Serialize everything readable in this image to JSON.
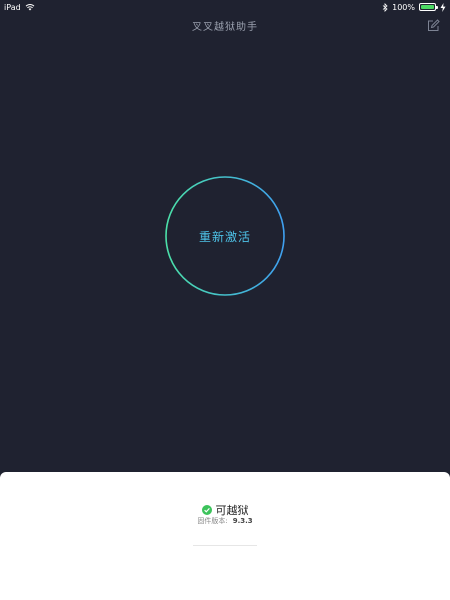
{
  "status_bar": {
    "device": "iPad",
    "battery": "100%"
  },
  "nav": {
    "title": "叉叉越狱助手",
    "edit_icon": "edit-icon"
  },
  "main": {
    "activate_label": "重新激活",
    "ring_colors": [
      "#4be0a8",
      "#3fa0f0"
    ]
  },
  "bottom": {
    "status_text": "可越狱",
    "status_color": "#3cc35b",
    "firmware_label": "固件版本:",
    "firmware_value": "9.3.3"
  }
}
